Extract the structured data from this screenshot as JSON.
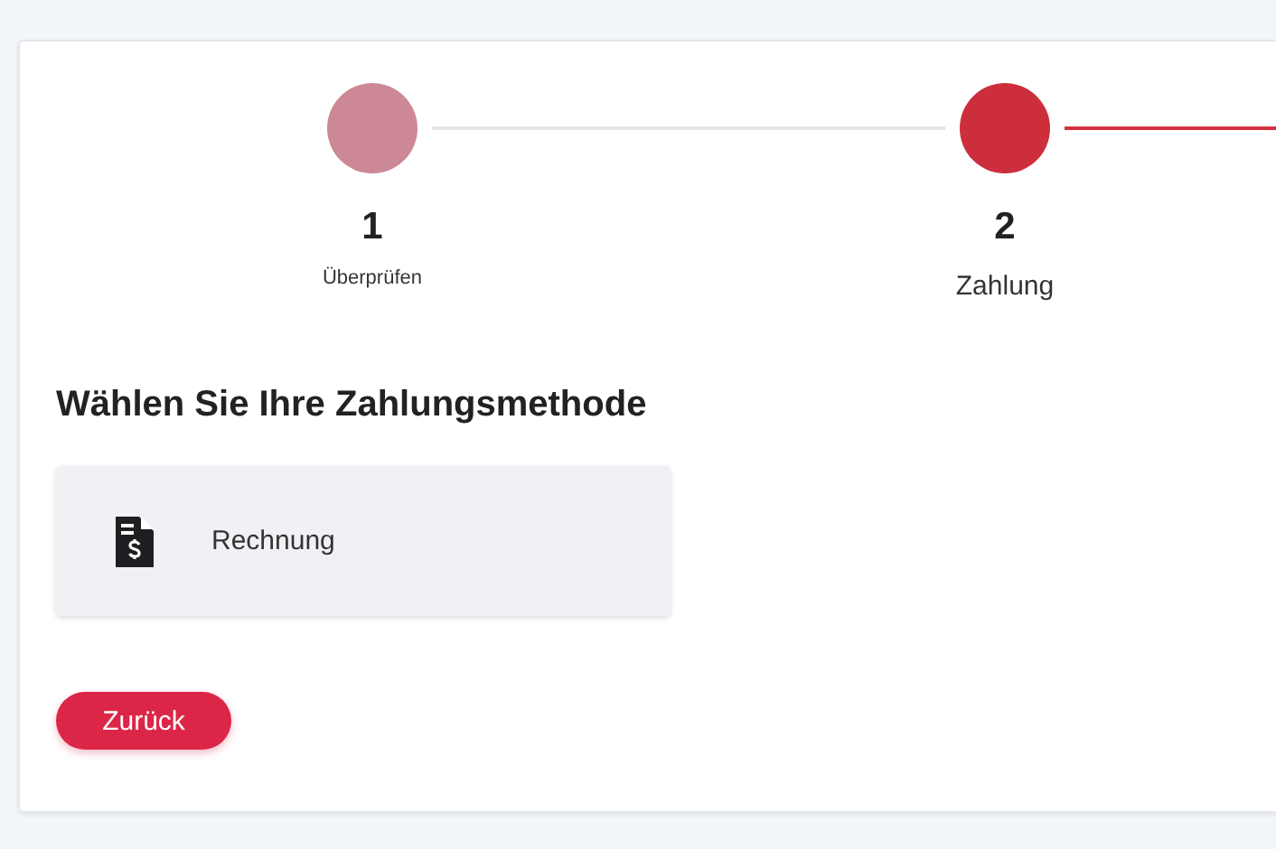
{
  "steps": [
    {
      "number": "1",
      "label": "Überprüfen",
      "selected": false
    },
    {
      "number": "2",
      "label": "Zahlung",
      "selected": true
    }
  ],
  "heading": "Wählen Sie Ihre Zahlungsmethode",
  "payment_methods": [
    {
      "label": "Rechnung"
    }
  ],
  "back_button": "Zurück"
}
